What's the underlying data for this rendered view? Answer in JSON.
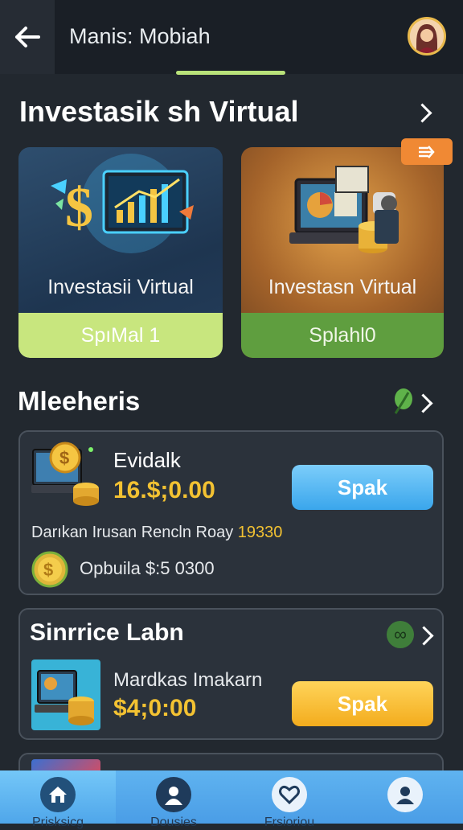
{
  "header": {
    "title": "Manis: Mobiah"
  },
  "featured": {
    "title": "Investasik sh Virtual",
    "cards": [
      {
        "label": "Investasii Virtual",
        "button": "SpıMal 1"
      },
      {
        "label": "Investasn Virtual",
        "button": "Splahl0"
      }
    ]
  },
  "section2": {
    "title": "Mleeheris",
    "item": {
      "name": "Evidalk",
      "amount": "16.$;0.00",
      "action": "Spak",
      "desc_prefix": "Darıkan Irusan Rencln Roay",
      "desc_value": "19330",
      "coin_text": "Opbuila $:5 0300"
    }
  },
  "section3": {
    "title": "Sinrrice Labn",
    "badge": "∞",
    "item": {
      "name": "Mardkas Imakarn",
      "amount": "$4;0:00",
      "action": "Spak"
    }
  },
  "colors": {
    "accent_green": "#b9e27a",
    "gold_text": "#f3c232",
    "blue_button": "#3aa6ec",
    "yellow_button": "#f3ac1d",
    "badge_orange": "#f08934"
  },
  "nav": [
    {
      "label": "Prisksicg",
      "icon": "home-icon"
    },
    {
      "label": "Dousies",
      "icon": "person-icon"
    },
    {
      "label": "Frsioriou",
      "icon": "heart-icon"
    },
    {
      "label": "",
      "icon": "profile-icon"
    }
  ]
}
